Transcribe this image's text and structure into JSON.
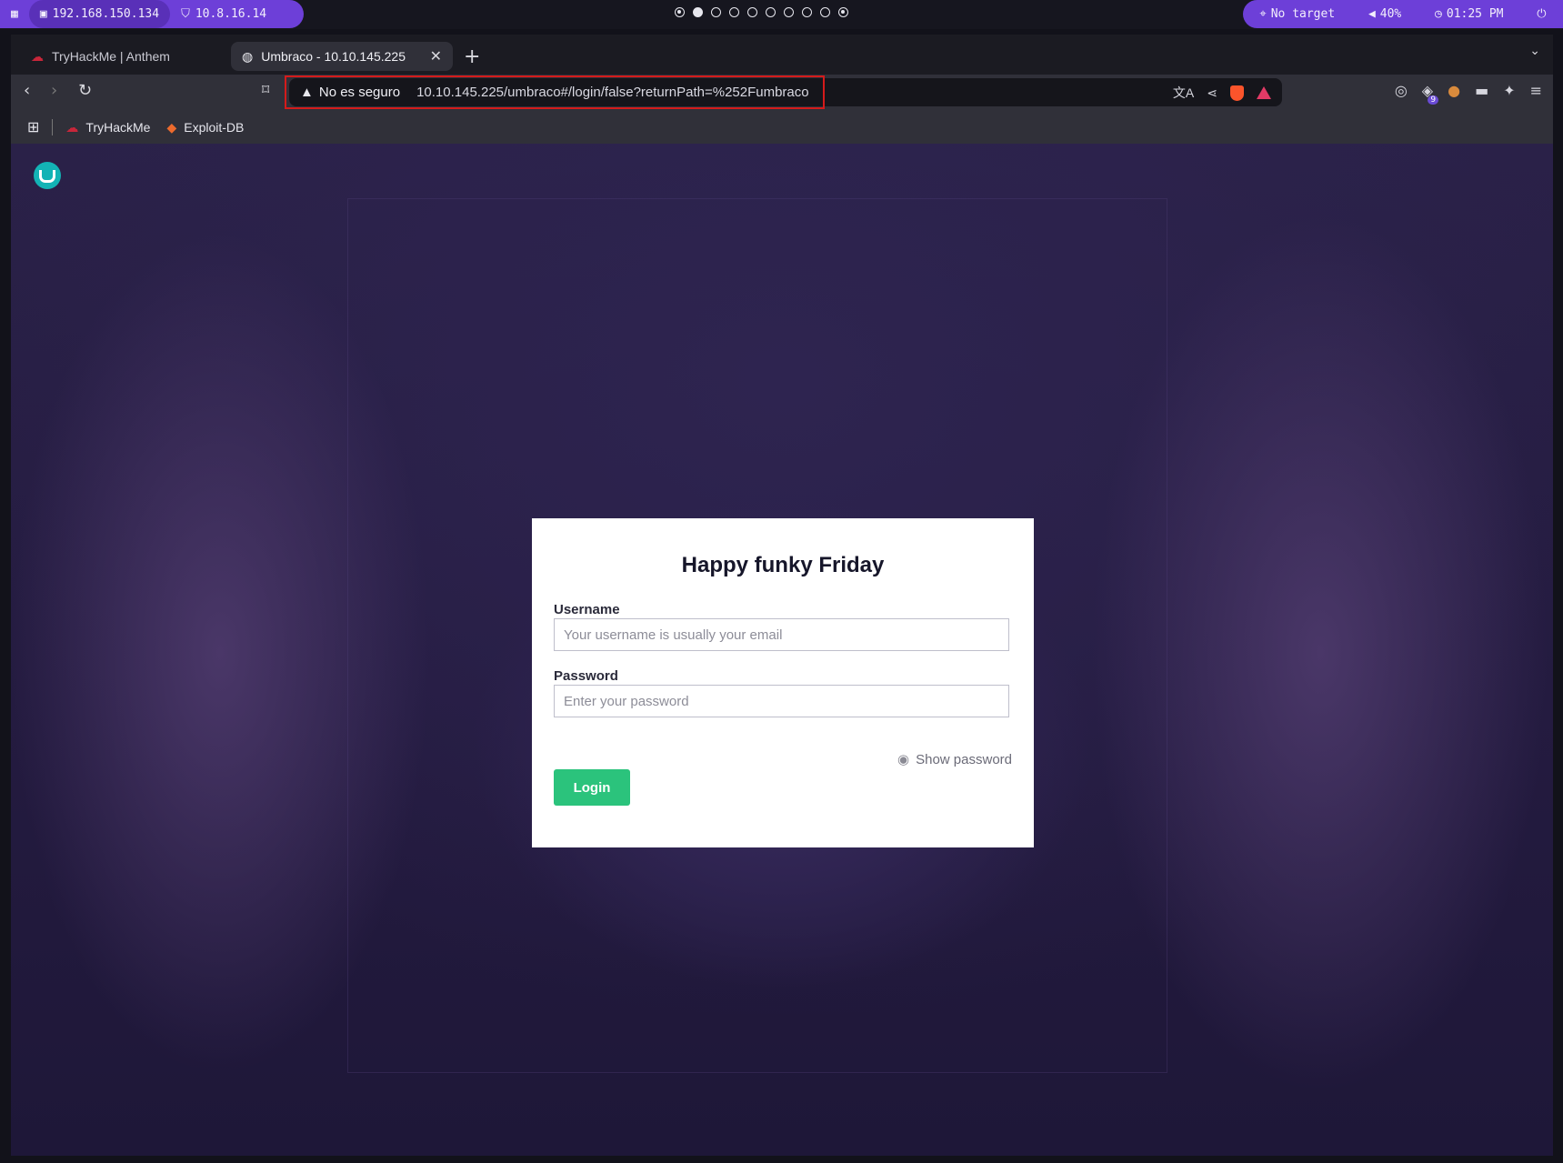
{
  "system_bar": {
    "menu_icon": "grid-icon",
    "ip_primary": "192.168.150.134",
    "ip_vpn": "10.8.16.14",
    "workspaces": [
      "target",
      "filled",
      "empty",
      "empty",
      "empty",
      "empty",
      "empty",
      "empty",
      "empty",
      "target"
    ],
    "target": "No target",
    "volume": "40%",
    "clock": "01:25 PM",
    "power_icon": "power-icon"
  },
  "browser": {
    "tabs": [
      {
        "label": "TryHackMe | Anthem",
        "icon": "tryhackme-icon"
      },
      {
        "label": "Umbraco - 10.10.145.225",
        "icon": "globe-icon"
      }
    ],
    "security_label": "No es seguro",
    "url": "10.10.145.225/umbraco#/login/false?returnPath=%252Fumbraco",
    "bookmarks": [
      {
        "label": "TryHackMe"
      },
      {
        "label": "Exploit-DB"
      }
    ]
  },
  "login": {
    "title": "Happy funky Friday",
    "username_label": "Username",
    "username_placeholder": "Your username is usually your email",
    "password_label": "Password",
    "password_placeholder": "Enter your password",
    "show_password": "Show password",
    "login_button": "Login"
  },
  "colors": {
    "accent_purple": "#6d3fd8",
    "umbraco_teal": "#13b3b5",
    "login_green": "#2bc37c",
    "url_highlight": "#d41b1b"
  }
}
